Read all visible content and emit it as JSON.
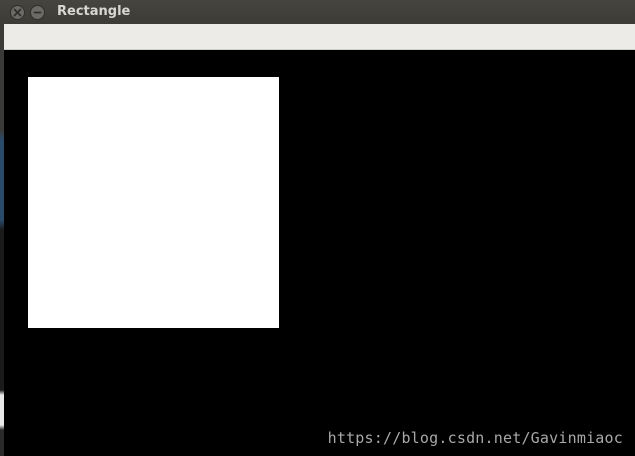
{
  "window": {
    "title": "Rectangle",
    "controls": {
      "close_icon": "close-icon",
      "minimize_icon": "minimize-icon"
    }
  },
  "canvas": {
    "background_color": "#000000",
    "shape": {
      "type": "rectangle",
      "fill_color": "#ffffff"
    }
  },
  "watermark": {
    "text": "https://blog.csdn.net/Gavinmiaoc"
  }
}
